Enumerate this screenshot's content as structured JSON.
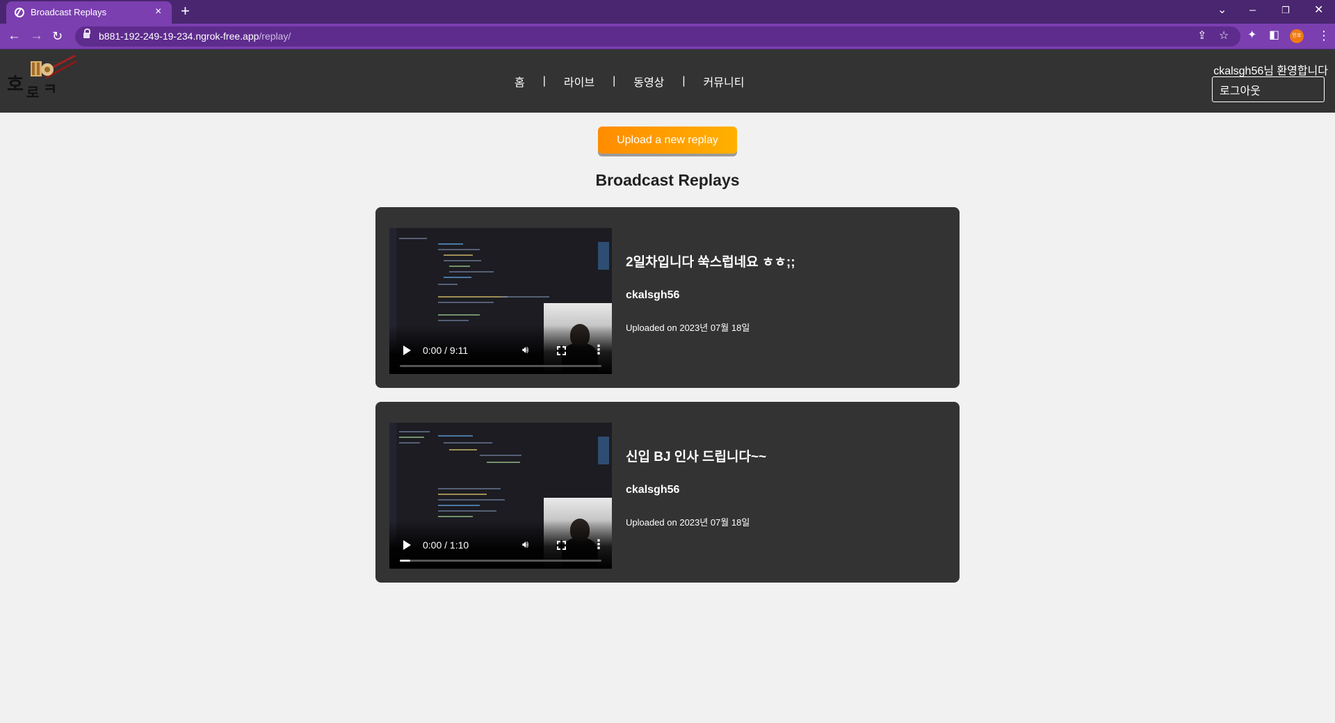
{
  "browser": {
    "tab_title": "Broadcast Replays",
    "tab_close": "×",
    "new_tab": "+",
    "url_host": "b881-192-249-19-234.ngrok-free.app",
    "url_path": "/replay/",
    "profile_label": "민호",
    "icons": [
      "back-icon",
      "forward-icon",
      "reload-icon",
      "lock-icon",
      "share-icon",
      "star-icon",
      "extensions-icon",
      "side-panel-icon",
      "menu-icon"
    ]
  },
  "header": {
    "nav": [
      "홈",
      "라이브",
      "동영상",
      "커뮤니티"
    ],
    "separator": "|",
    "welcome": "ckalsgh56님 환영합니다",
    "logout_label": "로그아웃"
  },
  "main": {
    "upload_label": "Upload a new replay",
    "title": "Broadcast Replays",
    "replays": [
      {
        "title": "2일차입니다 쑥스럽네요 ㅎㅎ;;",
        "user": "ckalsgh56",
        "uploaded": "Uploaded on 2023년 07월 18일",
        "time": "0:00 / 9:11",
        "progress": 0.0
      },
      {
        "title": "신입 BJ 인사 드립니다~~",
        "user": "ckalsgh56",
        "uploaded": "Uploaded on 2023년 07월 18일",
        "time": "0:00 / 1:10",
        "progress": 0.05
      }
    ]
  },
  "colors": {
    "tab_bar": "#4a2670",
    "address_bar": "#7b3fb0",
    "header_bg": "#333333",
    "card_bg": "#333333",
    "upload_gradient_start": "#ff8c00",
    "upload_gradient_end": "#ffb000",
    "page_bg": "#f1f1f1"
  }
}
